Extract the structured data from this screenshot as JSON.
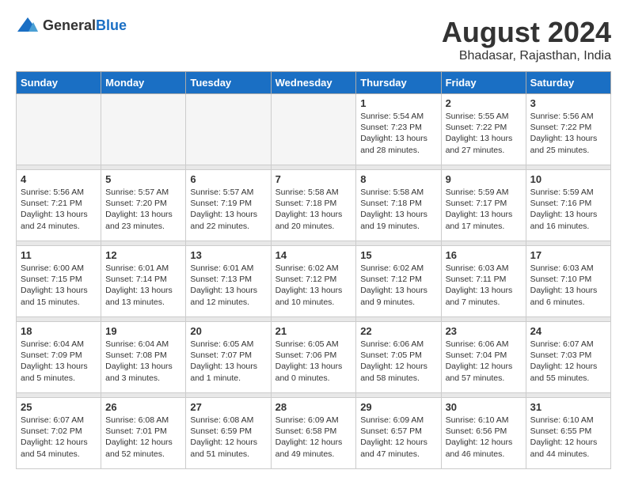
{
  "header": {
    "logo": {
      "general": "General",
      "blue": "Blue"
    },
    "title": "August 2024",
    "location": "Bhadasar, Rajasthan, India"
  },
  "weekdays": [
    "Sunday",
    "Monday",
    "Tuesday",
    "Wednesday",
    "Thursday",
    "Friday",
    "Saturday"
  ],
  "weeks": [
    [
      {
        "day": "",
        "info": ""
      },
      {
        "day": "",
        "info": ""
      },
      {
        "day": "",
        "info": ""
      },
      {
        "day": "",
        "info": ""
      },
      {
        "day": "1",
        "info": "Sunrise: 5:54 AM\nSunset: 7:23 PM\nDaylight: 13 hours\nand 28 minutes."
      },
      {
        "day": "2",
        "info": "Sunrise: 5:55 AM\nSunset: 7:22 PM\nDaylight: 13 hours\nand 27 minutes."
      },
      {
        "day": "3",
        "info": "Sunrise: 5:56 AM\nSunset: 7:22 PM\nDaylight: 13 hours\nand 25 minutes."
      }
    ],
    [
      {
        "day": "4",
        "info": "Sunrise: 5:56 AM\nSunset: 7:21 PM\nDaylight: 13 hours\nand 24 minutes."
      },
      {
        "day": "5",
        "info": "Sunrise: 5:57 AM\nSunset: 7:20 PM\nDaylight: 13 hours\nand 23 minutes."
      },
      {
        "day": "6",
        "info": "Sunrise: 5:57 AM\nSunset: 7:19 PM\nDaylight: 13 hours\nand 22 minutes."
      },
      {
        "day": "7",
        "info": "Sunrise: 5:58 AM\nSunset: 7:18 PM\nDaylight: 13 hours\nand 20 minutes."
      },
      {
        "day": "8",
        "info": "Sunrise: 5:58 AM\nSunset: 7:18 PM\nDaylight: 13 hours\nand 19 minutes."
      },
      {
        "day": "9",
        "info": "Sunrise: 5:59 AM\nSunset: 7:17 PM\nDaylight: 13 hours\nand 17 minutes."
      },
      {
        "day": "10",
        "info": "Sunrise: 5:59 AM\nSunset: 7:16 PM\nDaylight: 13 hours\nand 16 minutes."
      }
    ],
    [
      {
        "day": "11",
        "info": "Sunrise: 6:00 AM\nSunset: 7:15 PM\nDaylight: 13 hours\nand 15 minutes."
      },
      {
        "day": "12",
        "info": "Sunrise: 6:01 AM\nSunset: 7:14 PM\nDaylight: 13 hours\nand 13 minutes."
      },
      {
        "day": "13",
        "info": "Sunrise: 6:01 AM\nSunset: 7:13 PM\nDaylight: 13 hours\nand 12 minutes."
      },
      {
        "day": "14",
        "info": "Sunrise: 6:02 AM\nSunset: 7:12 PM\nDaylight: 13 hours\nand 10 minutes."
      },
      {
        "day": "15",
        "info": "Sunrise: 6:02 AM\nSunset: 7:12 PM\nDaylight: 13 hours\nand 9 minutes."
      },
      {
        "day": "16",
        "info": "Sunrise: 6:03 AM\nSunset: 7:11 PM\nDaylight: 13 hours\nand 7 minutes."
      },
      {
        "day": "17",
        "info": "Sunrise: 6:03 AM\nSunset: 7:10 PM\nDaylight: 13 hours\nand 6 minutes."
      }
    ],
    [
      {
        "day": "18",
        "info": "Sunrise: 6:04 AM\nSunset: 7:09 PM\nDaylight: 13 hours\nand 5 minutes."
      },
      {
        "day": "19",
        "info": "Sunrise: 6:04 AM\nSunset: 7:08 PM\nDaylight: 13 hours\nand 3 minutes."
      },
      {
        "day": "20",
        "info": "Sunrise: 6:05 AM\nSunset: 7:07 PM\nDaylight: 13 hours\nand 1 minute."
      },
      {
        "day": "21",
        "info": "Sunrise: 6:05 AM\nSunset: 7:06 PM\nDaylight: 13 hours\nand 0 minutes."
      },
      {
        "day": "22",
        "info": "Sunrise: 6:06 AM\nSunset: 7:05 PM\nDaylight: 12 hours\nand 58 minutes."
      },
      {
        "day": "23",
        "info": "Sunrise: 6:06 AM\nSunset: 7:04 PM\nDaylight: 12 hours\nand 57 minutes."
      },
      {
        "day": "24",
        "info": "Sunrise: 6:07 AM\nSunset: 7:03 PM\nDaylight: 12 hours\nand 55 minutes."
      }
    ],
    [
      {
        "day": "25",
        "info": "Sunrise: 6:07 AM\nSunset: 7:02 PM\nDaylight: 12 hours\nand 54 minutes."
      },
      {
        "day": "26",
        "info": "Sunrise: 6:08 AM\nSunset: 7:01 PM\nDaylight: 12 hours\nand 52 minutes."
      },
      {
        "day": "27",
        "info": "Sunrise: 6:08 AM\nSunset: 6:59 PM\nDaylight: 12 hours\nand 51 minutes."
      },
      {
        "day": "28",
        "info": "Sunrise: 6:09 AM\nSunset: 6:58 PM\nDaylight: 12 hours\nand 49 minutes."
      },
      {
        "day": "29",
        "info": "Sunrise: 6:09 AM\nSunset: 6:57 PM\nDaylight: 12 hours\nand 47 minutes."
      },
      {
        "day": "30",
        "info": "Sunrise: 6:10 AM\nSunset: 6:56 PM\nDaylight: 12 hours\nand 46 minutes."
      },
      {
        "day": "31",
        "info": "Sunrise: 6:10 AM\nSunset: 6:55 PM\nDaylight: 12 hours\nand 44 minutes."
      }
    ]
  ]
}
